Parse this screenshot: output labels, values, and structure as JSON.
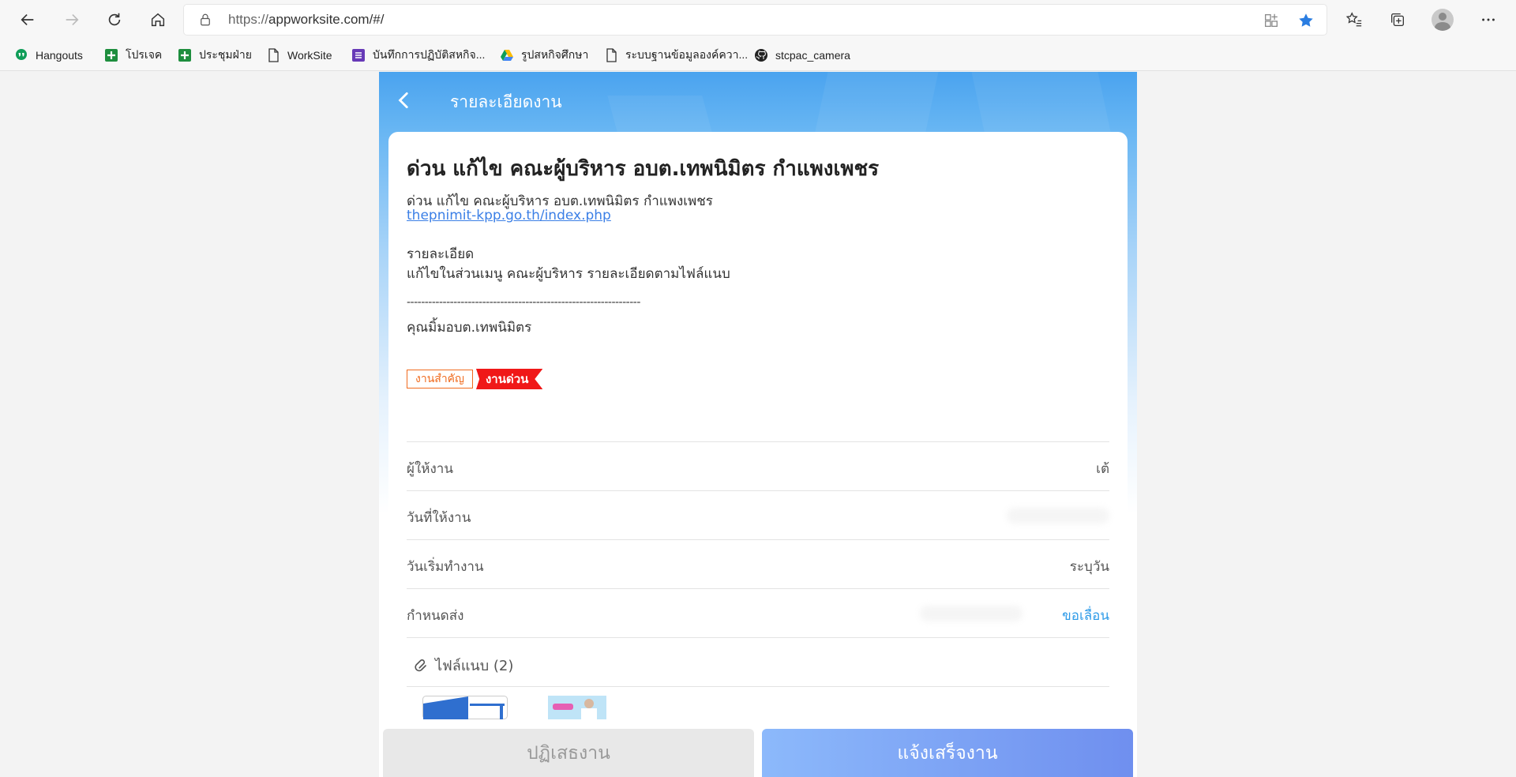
{
  "browser": {
    "url_scheme": "https://",
    "url_rest": "appworksite.com/#/",
    "bookmarks": [
      {
        "label": "Hangouts",
        "icon": "hangouts-icon"
      },
      {
        "label": "โปรเจค",
        "icon": "google-sheets-icon"
      },
      {
        "label": "ประชุมฝ่าย",
        "icon": "google-sheets-icon"
      },
      {
        "label": "WorkSite",
        "icon": "page-icon"
      },
      {
        "label": "บันทึกการปฏิบัติสหกิจ...",
        "icon": "google-forms-icon"
      },
      {
        "label": "รูปสหกิจศึกษา",
        "icon": "google-drive-icon"
      },
      {
        "label": "ระบบฐานข้อมูลองค์ควา...",
        "icon": "page-icon"
      },
      {
        "label": "stcpac_camera",
        "icon": "github-icon"
      }
    ]
  },
  "header": {
    "title": "รายละเอียดงาน"
  },
  "task": {
    "title": "ด่วน แก้ไข คณะผู้บริหาร อบต.เทพนิมิตร กำแพงเพชร",
    "line1": "ด่วน แก้ไข คณะผู้บริหาร อบต.เทพนิมิตร กำแพงเพชร",
    "link": "thepnimit-kpp.go.th/index.php",
    "detail_heading": "รายละเอียด",
    "detail_text": "แก้ไขในส่วนเมนู คณะผู้บริหาร รายละเอียดตามไฟล์แนบ",
    "separator": "-----------------------------------------------------------------",
    "contact": "คุณมิ้มอบต.เทพนิมิตร",
    "tag_important": "งานสำคัญ",
    "tag_urgent": "งานด่วน"
  },
  "fields": {
    "assigner_label": "ผู้ให้งาน",
    "assigner_value": "เต้",
    "assign_date_label": "วันที่ให้งาน",
    "start_date_label": "วันเริ่มทำงาน",
    "start_date_value": "ระบุวัน",
    "due_label": "กำหนดส่ง",
    "due_value": "ขอเลื่อน"
  },
  "attachments": {
    "label": "ไฟล์แนบ (2)"
  },
  "actions": {
    "reject": "ปฏิเสธงาน",
    "done": "แจ้งเสร็จงาน"
  },
  "colors": {
    "header_blue": "#4aa3ef",
    "urgent_red": "#f01818",
    "important_orange": "#f06b1f",
    "link_blue": "#3b7fe6",
    "done_button": "#7a9ef2"
  }
}
